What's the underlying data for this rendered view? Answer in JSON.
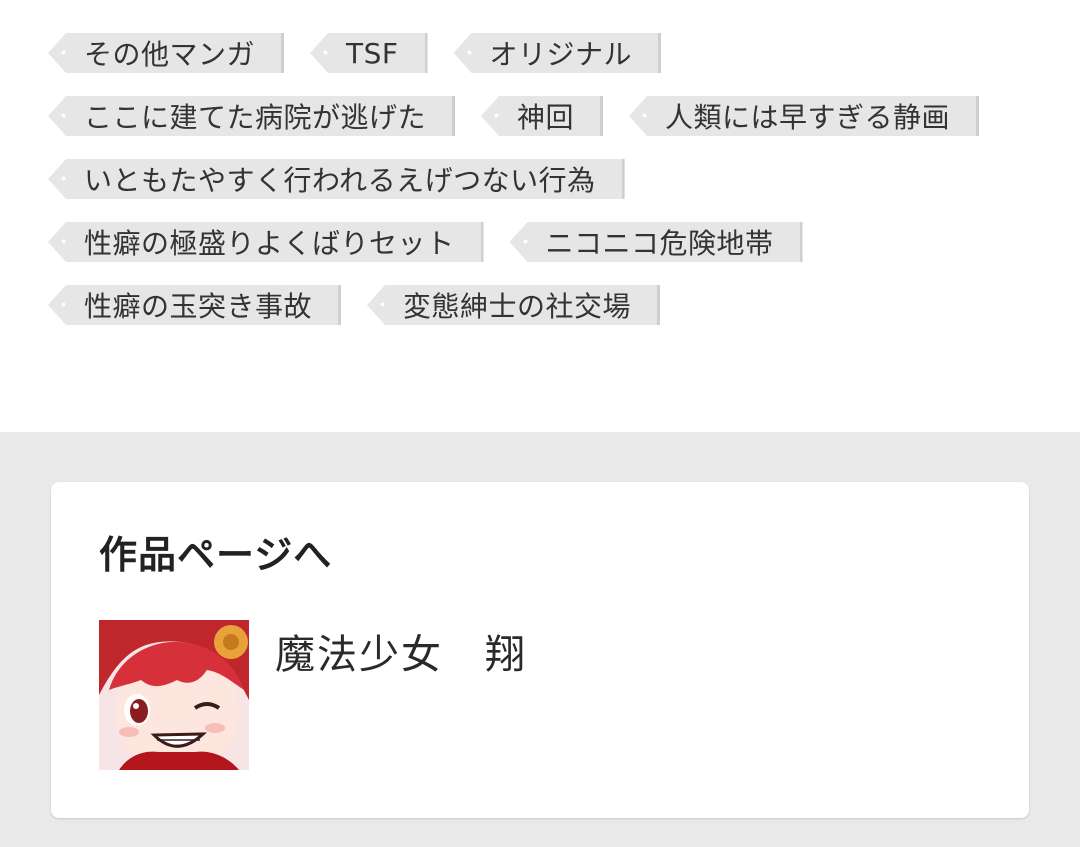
{
  "tags": {
    "rows": [
      [
        "その他マンガ",
        "TSF",
        "オリジナル"
      ],
      [
        "ここに建てた病院が逃げた",
        "神回",
        "人類には早すぎる静画"
      ],
      [
        "いともたやすく行われるえげつない行為"
      ],
      [
        "性癖の極盛りよくばりセット",
        "ニコニコ危険地帯"
      ],
      [
        "性癖の玉突き事故",
        "変態紳士の社交場"
      ]
    ]
  },
  "work_section": {
    "heading": "作品ページへ",
    "work_title": "魔法少女　翔",
    "thumbnail_icon": "character-thumbnail"
  },
  "colors": {
    "tag_bg": "#e6e6e6",
    "page_bg": "#ffffff",
    "lower_bg": "#e9e9e9",
    "card_bg": "#ffffff"
  }
}
